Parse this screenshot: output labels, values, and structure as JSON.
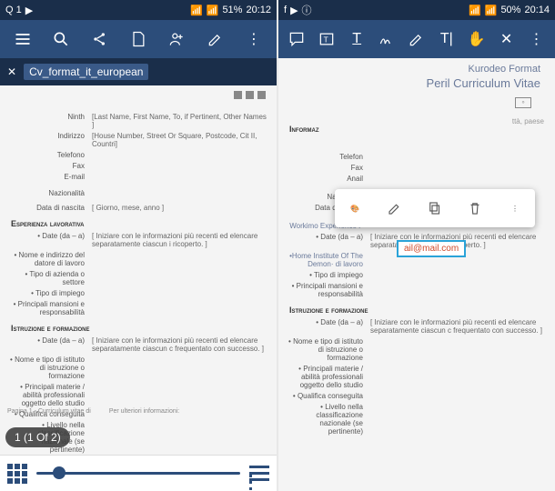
{
  "left": {
    "status": {
      "carrier": "Q 1",
      "battery": "51%",
      "time": "20:12"
    },
    "filename": "Cv_format_it_european",
    "doc": {
      "fields": {
        "ninth": "Ninth",
        "indirizzo": "Indirizzo",
        "telefono": "Telefono",
        "fax": "Fax",
        "email": "E-mail",
        "nazionalita": "Nazionalità",
        "dob": "Data di nascita"
      },
      "values": {
        "name_line": "[Last Name, First Name, To, if Pertinent, Other Names ]",
        "addr_line": "[House Number, Street Or Square, Postcode, Cit II, Countri]",
        "dob": "[ Giorno, mese, anno ]"
      },
      "sections": {
        "esperienza": "Esperienza lavorativa",
        "date": "• Date (da – a)",
        "exp_hint": "[ Iniziare con le informazioni più recenti ed elencare separatamente ciascun i ricoperto. ]",
        "nome_datore": "• Nome e indirizzo del datore di lavoro",
        "tipo_azienda": "• Tipo di azienda o settore",
        "tipo_impiego": "• Tipo di impiego",
        "mansioni": "• Principali mansioni e responsabilità",
        "istruzione": "Istruzione e formazione",
        "ist_hint": "[ Iniziare con le informazioni più recenti ed elencare separatamente ciascun c frequentato con successo. ]",
        "istituto": "• Nome e tipo di istituto di istruzione o formazione",
        "materie": "• Principali materie / abilità professionali oggetto dello studio",
        "qualifica": "• Qualifica conseguita",
        "livello": "• Livello nella classificazione nazionale (se pertinente)"
      },
      "footer": {
        "page": "Pagina 1 - Curriculum vitae di",
        "more": "Per ulteriori informazioni:"
      }
    },
    "pager": "1 (1 Of 2)"
  },
  "right": {
    "status": {
      "battery": "50%",
      "time": "20:14"
    },
    "doc": {
      "title1": "Kurodeo Format",
      "title2": "Peril Curriculum Vitae",
      "section_info": "Informaz",
      "crop": "ttà, paese",
      "fields": {
        "telefon": "Telefon",
        "fax": "Fax",
        "anail": "Anail",
        "nazionalita": "Nazionalità",
        "dob": "Data di nascita"
      },
      "selected_text": "ail@mail.com",
      "sections": {
        "work": "Workimo Experience F",
        "date": "• Date (da – a)",
        "exp_hint": "[ Iniziare con le informazioni più recenti ed elencare separatamente ciascun i ricoperto. ]",
        "home": "•Home Institute Of The Demon· di lavoro",
        "tipo_impiego": "• Tipo di impiego",
        "mansioni": "• Principali mansioni e responsabilità",
        "istruzione": "Istruzione e formazione",
        "ist_hint": "[ Iniziare con le informazioni più recenti ed elencare separatamente ciascun c frequentato con successo. ]",
        "istituto": "• Nome e tipo di istituto di istruzione o formazione",
        "materie": "• Principali materie / abilità professionali oggetto dello studio",
        "qualifica": "• Qualifica conseguita",
        "livello": "• Livello nella classificazione nazionale (se pertinente)"
      }
    }
  }
}
